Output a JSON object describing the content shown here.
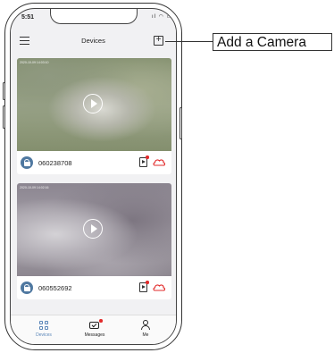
{
  "status_bar": {
    "time": "5:51",
    "icons": "ıl ◠ ▭"
  },
  "header": {
    "title": "Devices"
  },
  "devices": [
    {
      "timestamp": "2020-10-09  14:03:10",
      "device_id": "060238708"
    },
    {
      "timestamp": "2020-10-09  14:02:16",
      "device_id": "060552692"
    }
  ],
  "tabbar": {
    "tabs": [
      {
        "label": "Devices",
        "icon": "grid-icon",
        "active": true
      },
      {
        "label": "Messages",
        "icon": "envelope-icon",
        "active": false
      },
      {
        "label": "Me",
        "icon": "person-icon",
        "active": false
      }
    ]
  },
  "annotation": {
    "label": "Add a Camera"
  },
  "colors": {
    "accent": "#5a86b8",
    "badge_red": "#e22b2b",
    "lock_blue": "#4f78a0"
  }
}
